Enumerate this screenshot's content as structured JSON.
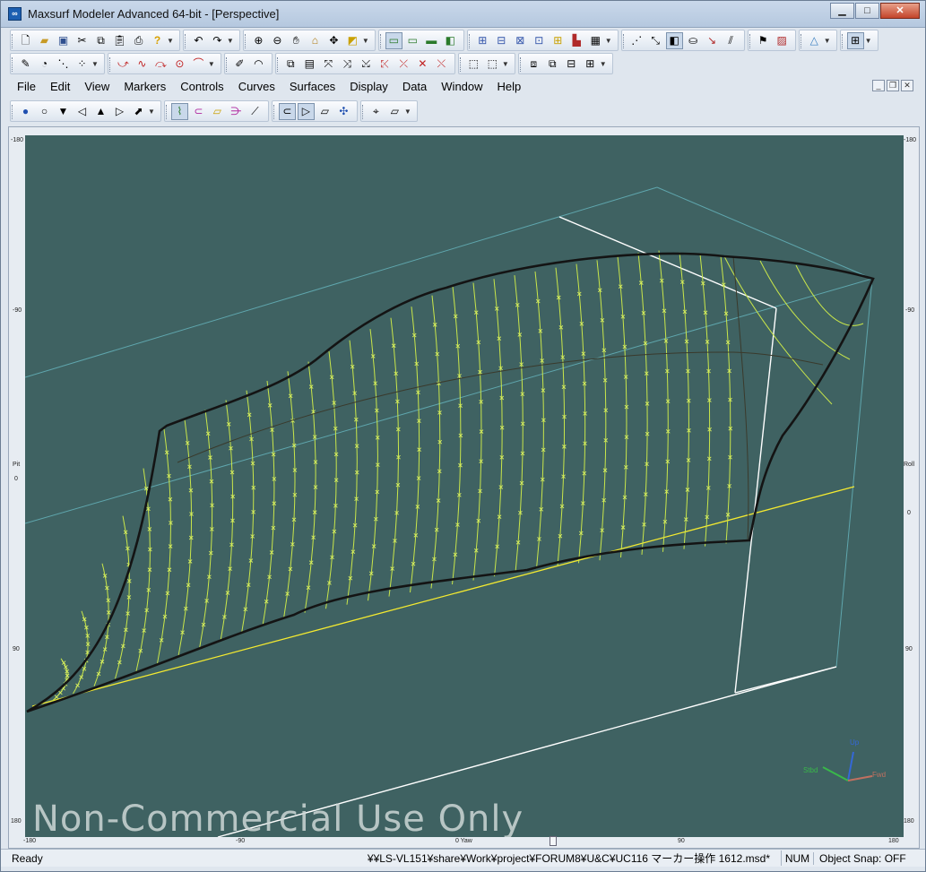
{
  "window": {
    "title": "Maxsurf Modeler Advanced 64-bit - [Perspective]",
    "app_icon": "maxsurf-logo-icon",
    "controls": [
      "minimize-icon",
      "maximize-icon",
      "close-icon"
    ]
  },
  "toolbar_row1": {
    "groups": [
      [
        "new-file-icon",
        "open-folder-icon",
        "save-icon"
      ],
      [
        "cut-icon",
        "copy-icon",
        "paste-icon"
      ],
      [
        "print-icon"
      ],
      [
        "help-icon"
      ],
      [
        "undo-icon",
        "redo-icon"
      ],
      [
        "zoom-in-icon",
        "zoom-out-icon",
        "pan-hand-icon",
        "home-view-icon",
        "rotate-icon",
        "marker-tool-icon"
      ],
      [
        "shade-render-icon",
        "wireframe-icon",
        "surface-icon",
        "plan-view-icon"
      ],
      [
        "table-icon",
        "grid-icon",
        "graph-icon",
        "calculator-icon",
        "data-icon",
        "chart-icon",
        "spreadsheet-icon"
      ],
      [
        "contour-icon",
        "curve-edit-icon",
        "display-icon",
        "pointer-icon",
        "arrow-icon",
        "lines-icon"
      ],
      [
        "flag-icon",
        "hatch-icon"
      ],
      [
        "triangle-icon"
      ],
      [
        "window-layout-icon"
      ]
    ]
  },
  "toolbar_row2": {
    "groups": [
      [
        "pencil-icon",
        "lasso-icon"
      ],
      [
        "magic-select-icon",
        "multi-select-icon"
      ],
      [
        "bend-icon",
        "spline-icon",
        "control-point-icon",
        "circle-point-icon",
        "arc-icon"
      ],
      [
        "brush-icon",
        "curve-icon"
      ],
      [
        "copy-shape-icon",
        "paste-shape-icon",
        "transform-icon",
        "scale-icon",
        "flip-icon",
        "delete-row-icon",
        "delete-col-icon",
        "trim-icon",
        "cross-icon"
      ],
      [
        "frame-select-icon",
        "bounding-icon"
      ],
      [
        "group-icon",
        "ungroup-icon",
        "align-icon",
        "distribute-icon"
      ]
    ]
  },
  "menu": {
    "items": [
      "File",
      "Edit",
      "View",
      "Markers",
      "Controls",
      "Curves",
      "Surfaces",
      "Display",
      "Data",
      "Window",
      "Help"
    ]
  },
  "toolbar_row3": {
    "groups": [
      [
        "sphere-icon",
        "circle-outline-icon",
        "funnel-icon",
        "cone-icon",
        "pyramid-icon",
        "arrow-fill-icon",
        "tool-select-icon"
      ],
      [
        "ship-lines-icon",
        "hull-section-icon",
        "waterline-icon",
        "buttock-icon",
        "diagonal-icon"
      ],
      [
        "profile-view-icon",
        "body-plan-icon",
        "deck-icon",
        "rotate-view-icon"
      ],
      [
        "shade-icon",
        "render-icon"
      ]
    ]
  },
  "rulers": {
    "left": [
      "-180",
      "-90",
      "Pit",
      "0",
      "90",
      "180"
    ],
    "right": [
      "-180",
      "-90",
      "Roll",
      "0",
      "90",
      "180"
    ],
    "bottom": [
      "-180",
      "-90",
      "0 Yaw",
      "90",
      "180"
    ]
  },
  "viewport": {
    "background": "#3f6262",
    "watermark": "Non-Commercial Use Only",
    "axes": {
      "up": "Up",
      "stbd": "Stbd",
      "fwd": "Fwd"
    },
    "colors": {
      "outline": "#141414",
      "station_lines": "#c9e64a",
      "marker": "#d9f060",
      "box_edges": "#5fa6ad",
      "white_lines": "#ffffff",
      "baseline": "#f4ea30",
      "dark_curve": "#3a3a2c"
    }
  },
  "status": {
    "ready": "Ready",
    "path": "¥¥LS-VL151¥share¥Work¥project¥FORUM8¥U&C¥UC116 マーカー操作 1612.msd*",
    "num": "NUM",
    "snap": "Object Snap: OFF"
  }
}
